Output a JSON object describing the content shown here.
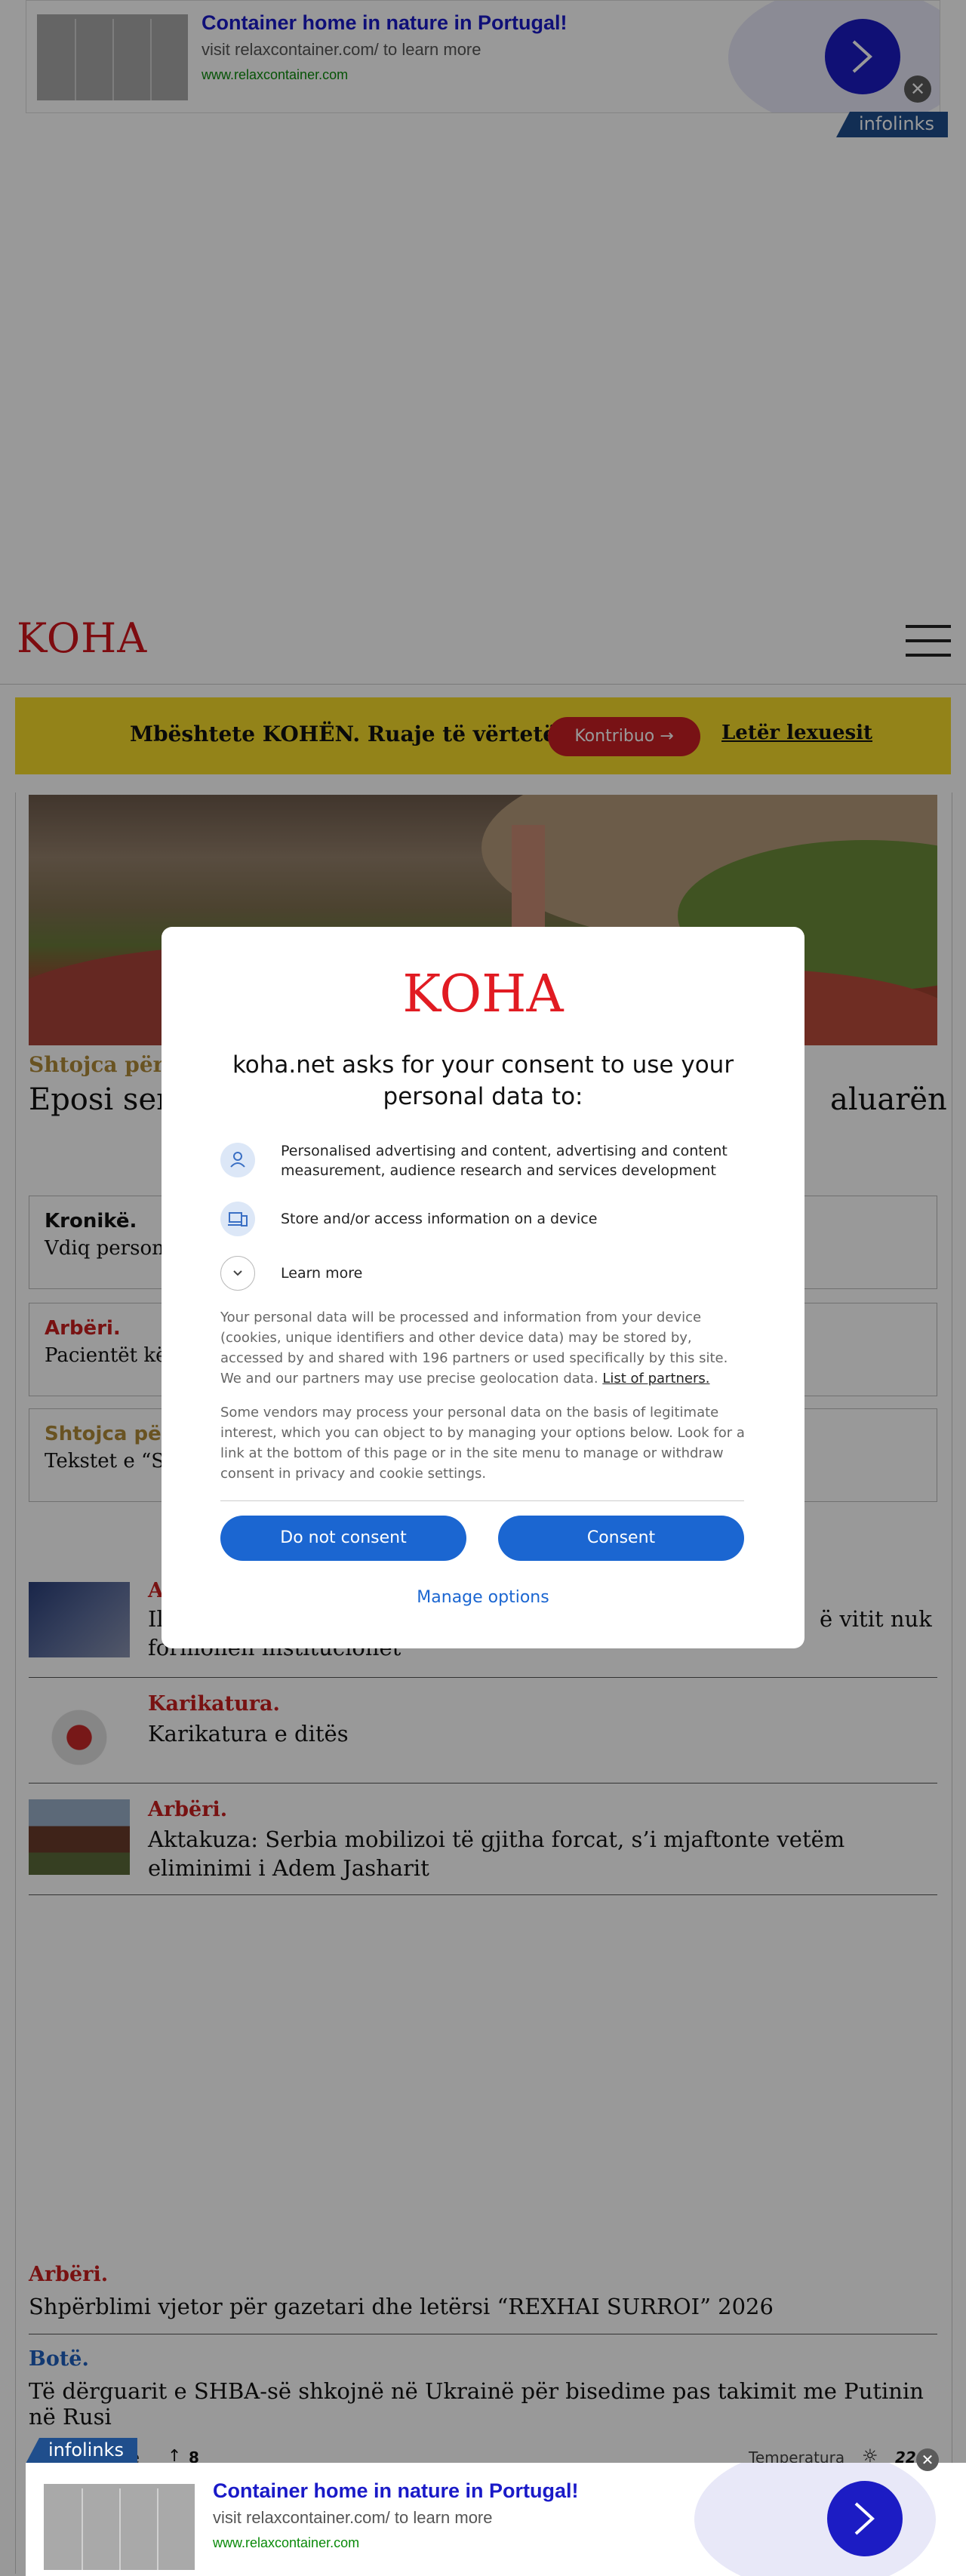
{
  "ads": {
    "title": "Container home in nature in Portugal!",
    "line2": "visit relaxcontainer.com/ to learn more",
    "url": "www.relaxcontainer.com",
    "brand": "infolinks"
  },
  "header": {
    "logo": "KOHA"
  },
  "banner": {
    "text": "Mbështete KOHËN. Ruaje të vërtetën",
    "button": "Kontribuo →",
    "link": "Letër lexuesit"
  },
  "lead": {
    "kicker": "Shtojca për l",
    "headline_left": "Eposi ser",
    "headline_right": "aluarën"
  },
  "cards": [
    {
      "kicker": "Kronikë.",
      "text": "Vdiq personi i",
      "kicker_color": "#111111"
    },
    {
      "kicker": "Arbëri.",
      "text": "Pacientët kërk",
      "kicker_color": "#c91e1e"
    },
    {
      "kicker": "Shtojca për l",
      "text": "Tekstet e “Sht",
      "kicker_color": "#b08a3a"
    }
  ],
  "list": [
    {
      "kicker": "A",
      "text": "Il",
      "text_right": "ë vitit nuk",
      "text_line2": "formohen institucionet"
    },
    {
      "kicker": "Karikatura.",
      "text": "Karikatura e ditës"
    },
    {
      "kicker": "Arbëri.",
      "text": "Aktakuza: Serbia mobilizoi të gjitha forcat, s’i mjaftonte vetëm eliminimi i Adem Jasharit"
    }
  ],
  "more": [
    {
      "kicker": "Arbëri.",
      "text": "Shpërblimi vjetor për gazetari dhe letërsi “REXHAI SURROI” 2026",
      "kicker_color": "#c91e1e"
    },
    {
      "kicker": "Botë.",
      "text": "Të dërguarit e SHBA-së shkojnë në Ukrainë për bisedime pas takimit me Putinin në Rusi",
      "kicker_color": "#1f5fbf"
    }
  ],
  "footer_strip": {
    "left": "në",
    "count": "8",
    "temp_label": "Temperatura",
    "temp_value": "22"
  },
  "consent": {
    "logo": "KOHA",
    "heading": "koha.net asks for your consent to use your personal data to:",
    "purposes": [
      {
        "icon": "person-icon",
        "label": "Personalised advertising and content, advertising and content measurement, audience research and services development"
      },
      {
        "icon": "devices-icon",
        "label": "Store and/or access information on a device"
      },
      {
        "icon": "chevron-down-icon",
        "label": "Learn more"
      }
    ],
    "para1": "Your personal data will be processed and information from your device (cookies, unique identifiers and other device data) may be stored by, accessed by and shared with 196 partners or used specifically by this site. We and our partners may use precise geolocation data.",
    "partners_link": "List of partners.",
    "para2": "Some vendors may process your personal data on the basis of legitimate interest, which you can object to by managing your options below. Look for a link at the bottom of this page or in the site menu to manage or withdraw consent in privacy and cookie settings.",
    "do_not_consent": "Do not consent",
    "consent": "Consent",
    "manage": "Manage options"
  }
}
